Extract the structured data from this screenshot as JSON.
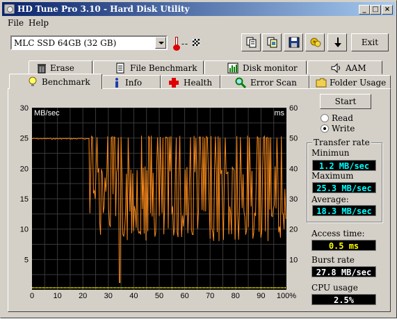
{
  "window": {
    "title": "HD Tune Pro 3.10 - Hard Disk Utility",
    "minimize": "_",
    "maximize": "□",
    "close": "×"
  },
  "menu": {
    "file": "File",
    "help": "Help"
  },
  "toolbar": {
    "drive": "MLC SSD 64GB (32 GB)",
    "temperature": "--",
    "exit_label": "Exit"
  },
  "tabs": {
    "row1": [
      "Erase",
      "File Benchmark",
      "Disk monitor",
      "AAM"
    ],
    "row2": [
      "Benchmark",
      "Info",
      "Health",
      "Error Scan",
      "Folder Usage"
    ],
    "active": "Benchmark"
  },
  "controls": {
    "start_label": "Start",
    "read_label": "Read",
    "write_label": "Write",
    "selected": "Write"
  },
  "stats": {
    "transfer_rate_title": "Transfer rate",
    "minimum_label": "Minimun",
    "minimum_value": "1.2 MB/sec",
    "maximum_label": "Maximum",
    "maximum_value": "25.3 MB/sec",
    "average_label": "Average:",
    "average_value": "18.3 MB/sec",
    "access_label": "Access time:",
    "access_value": "0.5 ms",
    "burst_label": "Burst rate",
    "burst_value": "27.8 MB/sec",
    "cpu_label": "CPU usage",
    "cpu_value": "2.5%"
  },
  "colors": {
    "transfer": "#ff8c1a",
    "access": "#ffff00",
    "grid": "#3a3a3a",
    "chart_bg": "#000000",
    "title_start": "#0a246a",
    "title_end": "#a6caf0"
  },
  "chart_data": {
    "type": "line",
    "title": "",
    "ylabel": "MB/sec",
    "y2label": "ms",
    "x_ticks": [
      "0",
      "10",
      "20",
      "30",
      "40",
      "50",
      "60",
      "70",
      "80",
      "90",
      "100%"
    ],
    "y_ticks": [
      "30",
      "25",
      "20",
      "15",
      "10",
      "5"
    ],
    "y2_ticks": [
      "60",
      "50",
      "40",
      "30",
      "20",
      "10"
    ],
    "xlim": [
      0,
      100
    ],
    "ylim": [
      0,
      30
    ],
    "y2lim": [
      0,
      60
    ],
    "grid": true,
    "series": [
      {
        "name": "",
        "color": "#ff8c1a",
        "values_desc": "transfer rate",
        "x": [
          0,
          10,
          20,
          22,
          23,
          24,
          25,
          26,
          27,
          28,
          29,
          30,
          31,
          32,
          33,
          34,
          35,
          36,
          37,
          38,
          39,
          40,
          42,
          45,
          50,
          55,
          60,
          65,
          70,
          75,
          80,
          85,
          90,
          95,
          100
        ],
        "y": [
          25,
          25,
          25,
          25,
          25,
          25,
          19,
          25,
          18,
          25,
          13,
          25,
          7,
          20,
          9,
          25,
          6,
          19,
          7,
          25,
          8,
          20,
          8,
          19,
          9,
          20,
          8,
          19,
          9,
          19,
          8,
          19,
          9,
          18,
          9
        ]
      },
      {
        "name": "",
        "color": "#ffff00",
        "values_desc": "access time",
        "x": [
          0,
          100
        ],
        "y": [
          0.5,
          0.5
        ]
      }
    ]
  }
}
